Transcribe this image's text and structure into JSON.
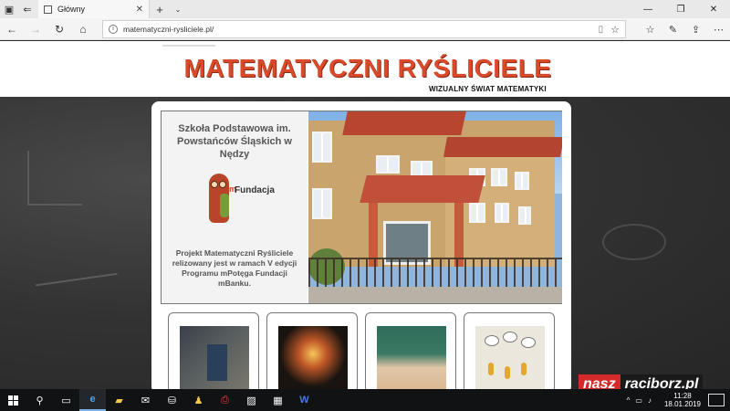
{
  "browser": {
    "tab_title": "Główny",
    "address_url": "matematyczni-rysliciele.pl/"
  },
  "header": {
    "logo": "MATEMATYCZNI RYŚLICIELE",
    "tagline": "WIZUALNY ŚWIAT MATEMATYKI"
  },
  "hero": {
    "school_name": "Szkoła Podstawowa im. Powstańców Śląskich w Nędzy",
    "foundation_logo_text": "Fundacja",
    "foundation_logo_mark": "m",
    "project_text": "Projekt Matematyczni Ryśliciele relizowany jest w ramach V edycji Programu mPotęga Fundacji mBanku."
  },
  "watermark": {
    "part1": "nasz",
    "part2": "raciborz.pl"
  },
  "taskbar": {
    "time": "11:28",
    "date": "18.01.2019"
  },
  "colors": {
    "logo_red": "#d94a2b",
    "accent_blue": "#7db1e8"
  }
}
